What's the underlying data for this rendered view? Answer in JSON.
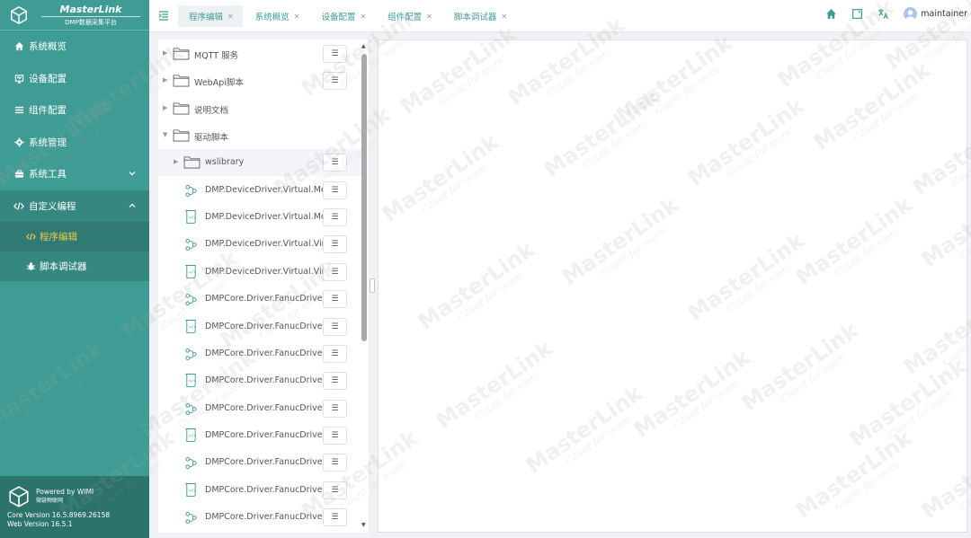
{
  "brand": {
    "title": "MasterLink",
    "subtitle": "DMP数据采集平台"
  },
  "sidebar": {
    "items": [
      {
        "label": "系统概览",
        "icon": "home-icon"
      },
      {
        "label": "设备配置",
        "icon": "device-icon"
      },
      {
        "label": "组件配置",
        "icon": "list-icon"
      },
      {
        "label": "系统管理",
        "icon": "gear-icon"
      },
      {
        "label": "系统工具",
        "icon": "toolbox-icon"
      },
      {
        "label": "自定义编程",
        "icon": "code-icon"
      }
    ],
    "sub_items": [
      {
        "label": "程序编辑",
        "icon": "code-icon",
        "active": true
      },
      {
        "label": "脚本调试器",
        "icon": "bug-icon",
        "active": false
      }
    ],
    "footer": {
      "powered": "Powered by WIMI",
      "powered_sub": "微链物联网",
      "core_version": "Core Version 16.5.8969.26158",
      "web_version": "Web Version 16.5.1"
    }
  },
  "tabs": [
    {
      "label": "程序编辑",
      "active": true
    },
    {
      "label": "系统概览",
      "active": false
    },
    {
      "label": "设备配置",
      "active": false
    },
    {
      "label": "组件配置",
      "active": false
    },
    {
      "label": "脚本调试器",
      "active": false
    }
  ],
  "header": {
    "user": "maintainer"
  },
  "tree": [
    {
      "label": "MQTT 服务",
      "kind": "folder",
      "level": 0,
      "caret": "right",
      "menu": true
    },
    {
      "label": "WebApi脚本",
      "kind": "folder",
      "level": 0,
      "caret": "right",
      "menu": true
    },
    {
      "label": "说明文档",
      "kind": "folder",
      "level": 0,
      "caret": "right",
      "menu": false
    },
    {
      "label": "驱动脚本",
      "kind": "folder",
      "level": 0,
      "caret": "down",
      "menu": false
    },
    {
      "label": "wslibrary",
      "kind": "folder",
      "level": 1,
      "caret": "right",
      "menu": true,
      "highlight": true
    },
    {
      "label": "DMP.DeviceDriver.Virtual.Me...",
      "kind": "flow",
      "level": 1,
      "menu": true
    },
    {
      "label": "DMP.DeviceDriver.Virtual.Me...",
      "kind": "script",
      "level": 1,
      "menu": true
    },
    {
      "label": "DMP.DeviceDriver.Virtual.Virt...",
      "kind": "flow",
      "level": 1,
      "menu": true
    },
    {
      "label": "DMP.DeviceDriver.Virtual.Virt...",
      "kind": "script",
      "level": 1,
      "menu": true
    },
    {
      "label": "DMPCore.Driver.FanucDriver....",
      "kind": "flow",
      "level": 1,
      "menu": true
    },
    {
      "label": "DMPCore.Driver.FanucDriver....",
      "kind": "script",
      "level": 1,
      "menu": true
    },
    {
      "label": "DMPCore.Driver.FanucDriver....",
      "kind": "flow",
      "level": 1,
      "menu": true
    },
    {
      "label": "DMPCore.Driver.FanucDriver....",
      "kind": "script",
      "level": 1,
      "menu": true
    },
    {
      "label": "DMPCore.Driver.FanucDriver....",
      "kind": "flow",
      "level": 1,
      "menu": true
    },
    {
      "label": "DMPCore.Driver.FanucDriver....",
      "kind": "script",
      "level": 1,
      "menu": true
    },
    {
      "label": "DMPCore.Driver.FanucDriver....",
      "kind": "flow",
      "level": 1,
      "menu": true
    },
    {
      "label": "DMPCore.Driver.FanucDriver....",
      "kind": "script",
      "level": 1,
      "menu": true
    },
    {
      "label": "DMPCore.Driver.FanucDriver....",
      "kind": "flow",
      "level": 1,
      "menu": true
    }
  ],
  "watermark": {
    "main": "MasterLink",
    "tag": "Count for more"
  },
  "colors": {
    "sidebar": "#3f9c94",
    "accent": "#3f9c94",
    "active_text": "#f2c94c"
  }
}
